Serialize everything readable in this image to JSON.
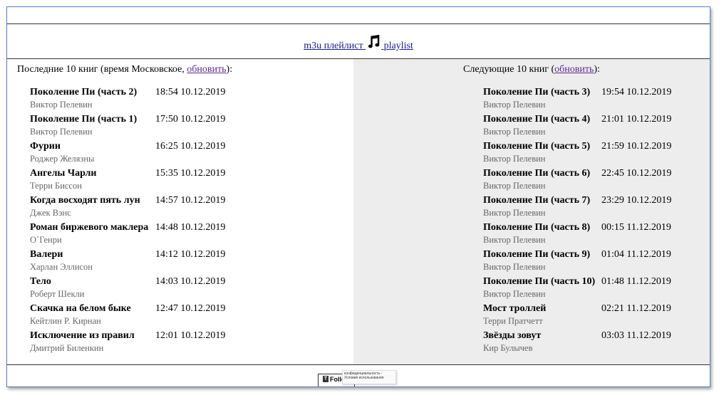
{
  "header": {
    "m3u_link": "m3u плейлист",
    "playlist_link": "playlist"
  },
  "left": {
    "heading_prefix": "Последние 10 книг (время Московское, ",
    "refresh_link": "обновить",
    "heading_suffix": "):",
    "items": [
      {
        "title": "Поколение Пи (часть 2)",
        "author": "Виктор Пелевин",
        "time": "18:54 10.12.2019"
      },
      {
        "title": "Поколение Пи (часть 1)",
        "author": "Виктор Пелевин",
        "time": "17:50 10.12.2019"
      },
      {
        "title": "Фурии",
        "author": "Роджер Желязны",
        "time": "16:25 10.12.2019"
      },
      {
        "title": "Ангелы Чарли",
        "author": "Терри Биссон",
        "time": "15:35 10.12.2019"
      },
      {
        "title": "Когда восходят пять лун",
        "author": "Джек Вэнс",
        "time": "14:57 10.12.2019"
      },
      {
        "title": "Роман биржевого маклера",
        "author": "О`Генри",
        "time": "14:48 10.12.2019"
      },
      {
        "title": "Валери",
        "author": "Харлан Эллисон",
        "time": "14:12 10.12.2019"
      },
      {
        "title": "Тело",
        "author": "Роберт Шекли",
        "time": "14:03 10.12.2019"
      },
      {
        "title": "Скачка на белом быке",
        "author": "Кейтлин Р. Кирнан",
        "time": "12:47 10.12.2019"
      },
      {
        "title": "Исключение из правил",
        "author": "Дмитрий Биленкин",
        "time": "12:01 10.12.2019"
      }
    ]
  },
  "right": {
    "heading_prefix": "Следующие 10 книг (",
    "refresh_link": "обновить",
    "heading_suffix": "):",
    "items": [
      {
        "title": "Поколение Пи (часть 3)",
        "author": "Виктор Пелевин",
        "time": "19:54 10.12.2019"
      },
      {
        "title": "Поколение Пи (часть 4)",
        "author": "Виктор Пелевин",
        "time": "21:01 10.12.2019"
      },
      {
        "title": "Поколение Пи (часть 5)",
        "author": "Виктор Пелевин",
        "time": "21:59 10.12.2019"
      },
      {
        "title": "Поколение Пи (часть 6)",
        "author": "Виктор Пелевин",
        "time": "22:45 10.12.2019"
      },
      {
        "title": "Поколение Пи (часть 7)",
        "author": "Виктор Пелевин",
        "time": "23:29 10.12.2019"
      },
      {
        "title": "Поколение Пи (часть 8)",
        "author": "Виктор Пелевин",
        "time": "00:15 11.12.2019"
      },
      {
        "title": "Поколение Пи (часть 9)",
        "author": "Виктор Пелевин",
        "time": "01:04 11.12.2019"
      },
      {
        "title": "Поколение Пи (часть 10)",
        "author": "Виктор Пелевин",
        "time": "01:48 11.12.2019"
      },
      {
        "title": "Мост троллей",
        "author": "Терри Пратчетт",
        "time": "02:21 11.12.2019"
      },
      {
        "title": "Звёзды зовут",
        "author": "Кир Булычев",
        "time": "03:03 11.12.2019"
      }
    ]
  },
  "footer": {
    "follow_label": "Follow",
    "follow_icon_letter": "T",
    "tooltip_text": "конфиденциальность - Условия использования"
  },
  "icons": {
    "music": "music-note-icon"
  },
  "colors": {
    "link": "#1a1a8c",
    "visited_link": "#5b2a8c",
    "right_pane_bg": "#ededed",
    "author_text": "#666666",
    "frame_border": "#5b7fbf"
  }
}
